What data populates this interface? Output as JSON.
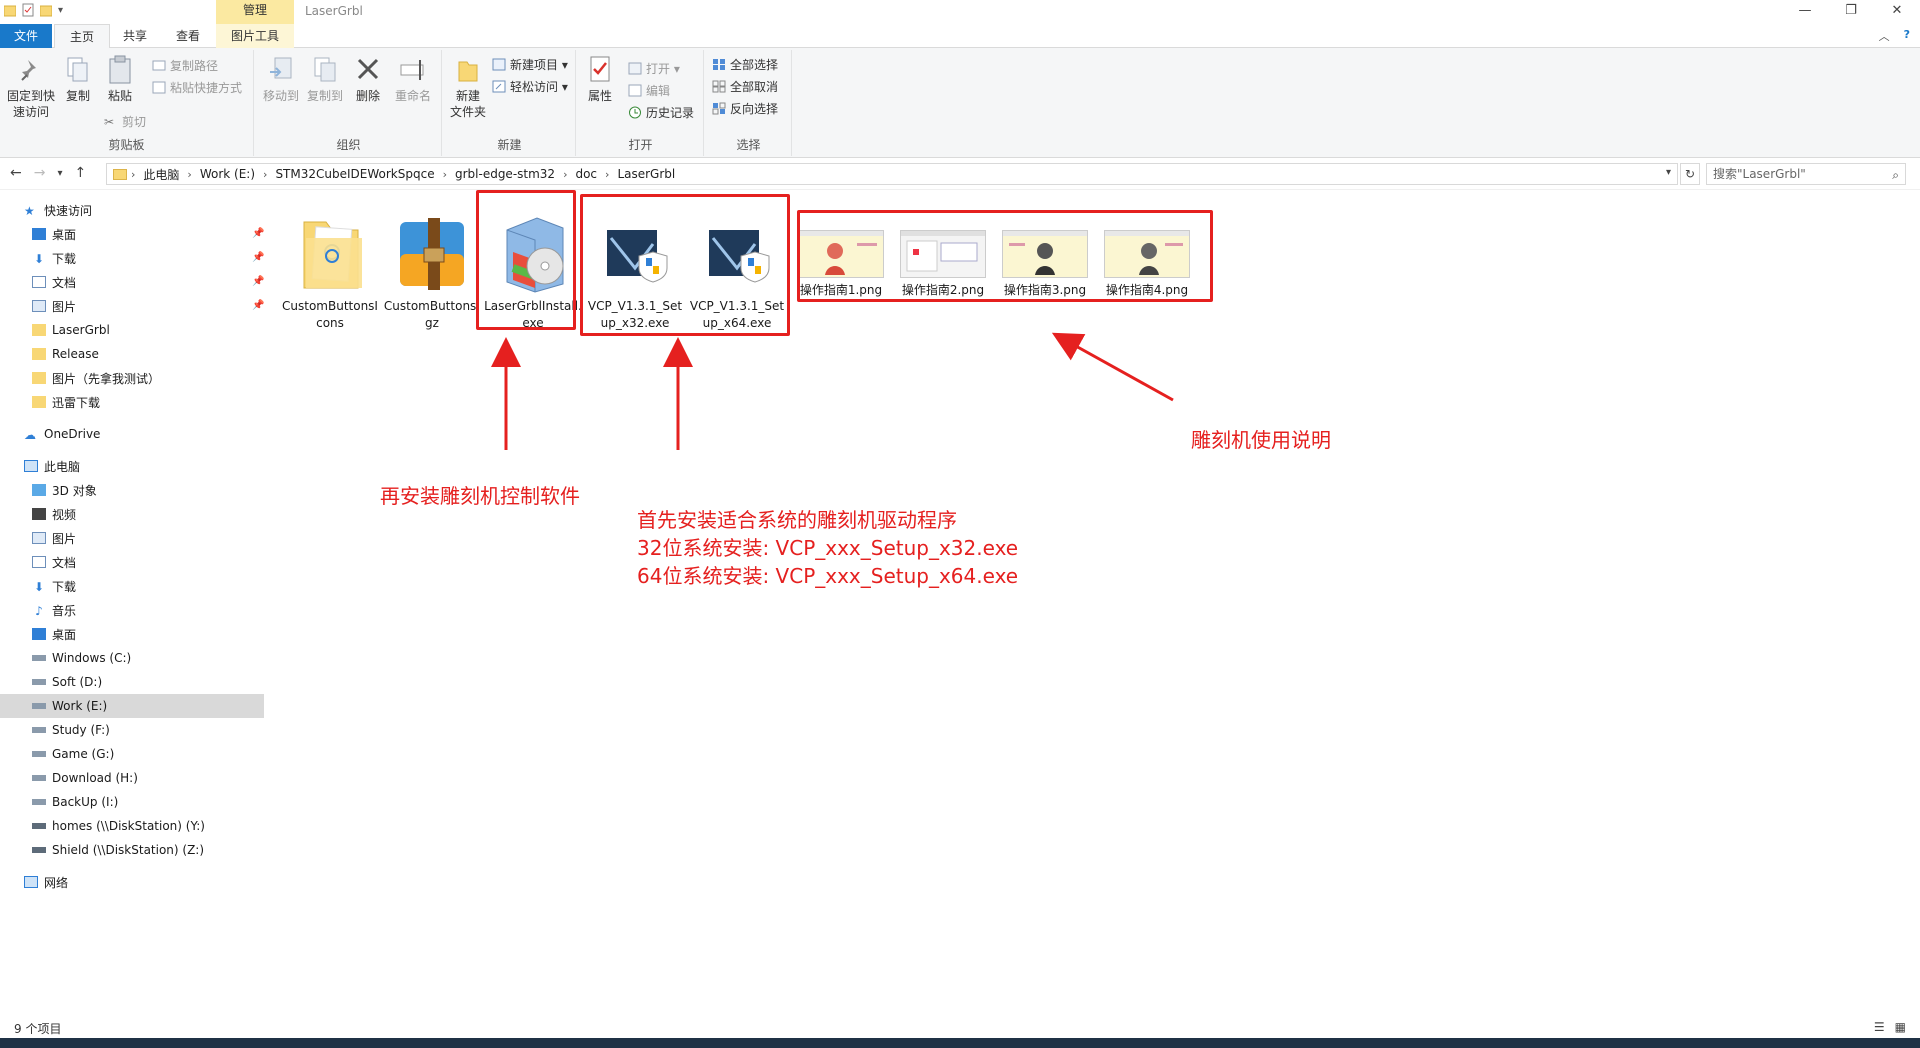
{
  "window": {
    "title": "LaserGrbl",
    "context_tab": "管理",
    "controls": [
      "—",
      "❐",
      "✕"
    ]
  },
  "tabs": [
    {
      "label": "文件"
    },
    {
      "label": "主页"
    },
    {
      "label": "共享"
    },
    {
      "label": "查看"
    },
    {
      "label": "图片工具"
    }
  ],
  "ribbon": {
    "clipboard": {
      "pin": "固定到快\n速访问",
      "copy": "复制",
      "paste": "粘贴",
      "copy_path": "复制路径",
      "paste_shortcut": "粘贴快捷方式",
      "cut": "剪切",
      "label": "剪贴板"
    },
    "organize": {
      "move_to": "移动到",
      "copy_to": "复制到",
      "delete": "删除",
      "rename": "重命名",
      "label": "组织"
    },
    "new": {
      "new_folder": "新建\n文件夹",
      "new_item": "新建项目 ▾",
      "easy_access": "轻松访问 ▾",
      "label": "新建"
    },
    "open": {
      "properties": "属性",
      "open": "打开 ▾",
      "edit": "编辑",
      "history": "历史记录",
      "label": "打开"
    },
    "select": {
      "select_all": "全部选择",
      "select_none": "全部取消",
      "invert": "反向选择",
      "label": "选择"
    }
  },
  "address": {
    "crumbs": [
      "此电脑",
      "Work (E:)",
      "STM32CubeIDEWorkSpqce",
      "grbl-edge-stm32",
      "doc",
      "LaserGrbl"
    ],
    "search_placeholder": "搜索\"LaserGrbl\""
  },
  "nav": {
    "quick_access": "快速访问",
    "quick_items": [
      "桌面",
      "下载",
      "文档",
      "图片",
      "LaserGrbl",
      "Release",
      "图片（先拿我测试）",
      "迅雷下载"
    ],
    "onedrive": "OneDrive",
    "this_pc": "此电脑",
    "pc_items": [
      "3D 对象",
      "视频",
      "图片",
      "文档",
      "下载",
      "音乐",
      "桌面",
      "Windows (C:)",
      "Soft (D:)",
      "Work (E:)",
      "Study (F:)",
      "Game (G:)",
      "Download (H:)",
      "BackUp (I:)",
      "homes (\\\\DiskStation) (Y:)",
      "Shield (\\\\DiskStation) (Z:)"
    ],
    "network": "网络",
    "selected": "Work (E:)"
  },
  "files": [
    {
      "name": "CustomButtonsIcons",
      "type": "folder"
    },
    {
      "name": "CustomButtons.gz",
      "type": "archive"
    },
    {
      "name": "LaserGrblInstall.exe",
      "type": "installer"
    },
    {
      "name": "VCP_V1.3.1_Setup_x32.exe",
      "type": "exe"
    },
    {
      "name": "VCP_V1.3.1_Setup_x64.exe",
      "type": "exe"
    },
    {
      "name": "操作指南1.png",
      "type": "png"
    },
    {
      "name": "操作指南2.png",
      "type": "png"
    },
    {
      "name": "操作指南3.png",
      "type": "png"
    },
    {
      "name": "操作指南4.png",
      "type": "png"
    }
  ],
  "annotations": {
    "install_software": "再安装雕刻机控制软件",
    "driver_line1": "首先安装适合系统的雕刻机驱动程序",
    "driver_line2": "32位系统安装: VCP_xxx_Setup_x32.exe",
    "driver_line3": "64位系统安装: VCP_xxx_Setup_x64.exe",
    "manual": "雕刻机使用说明",
    "color": "#e5201f"
  },
  "status": {
    "count": "9 个项目"
  }
}
